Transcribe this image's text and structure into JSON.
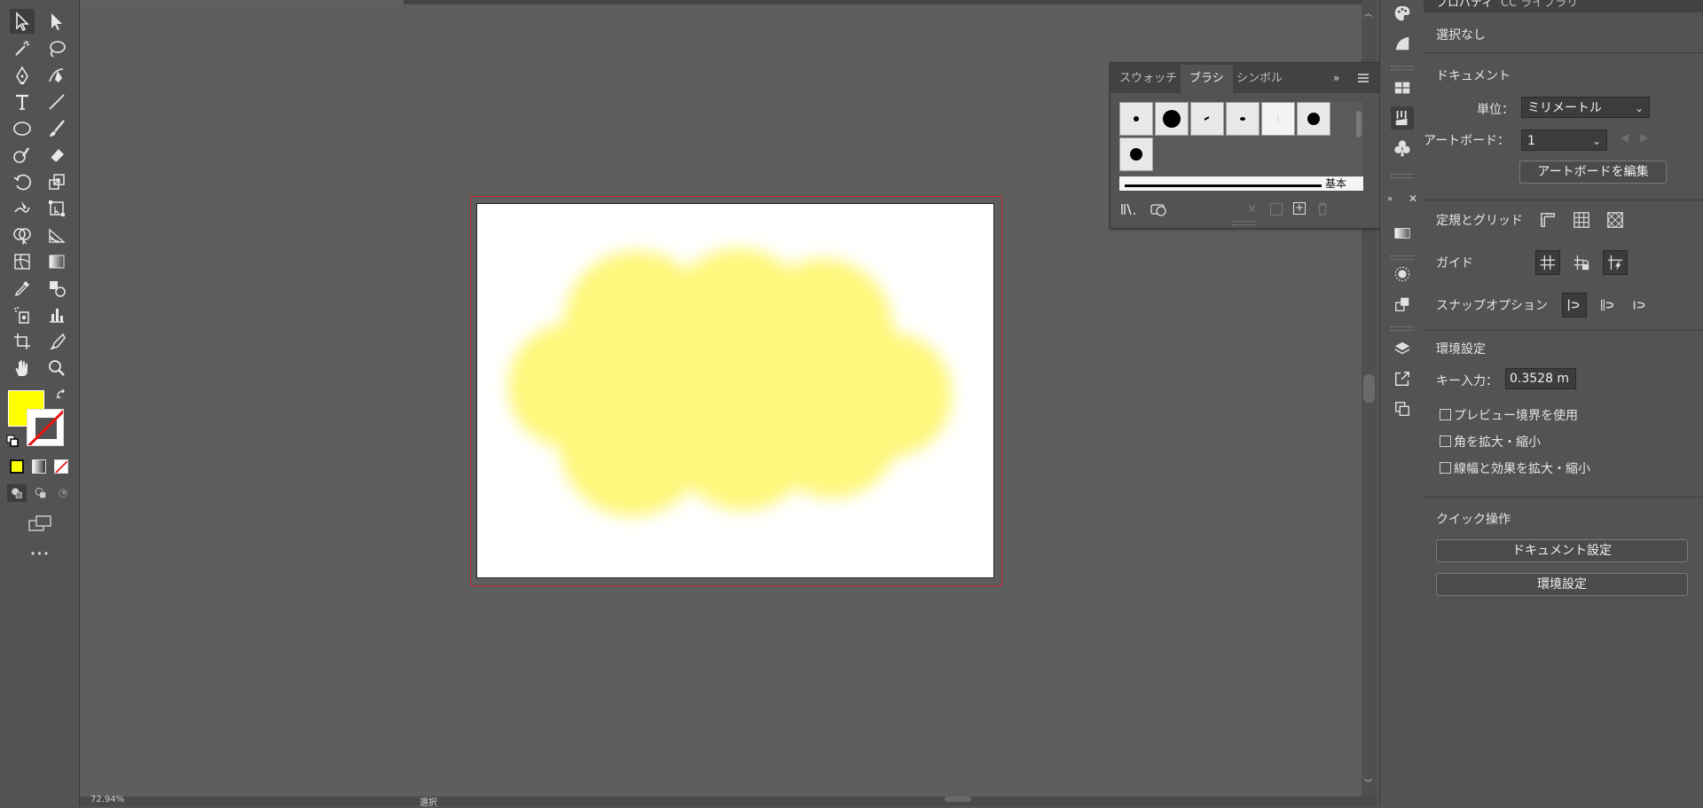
{
  "colors": {
    "fill": "#ffff00",
    "cloud": "#fff77a",
    "artboard_border": "#c0282d",
    "ui_bg": "#535353",
    "canvas_bg": "#5e5e5e"
  },
  "toolbar": {
    "tools": [
      "selection-tool",
      "direct-selection-tool",
      "magic-wand-tool",
      "lasso-tool",
      "pen-tool",
      "curvature-tool",
      "type-tool",
      "line-segment-tool",
      "ellipse-tool",
      "paintbrush-tool",
      "shaper-tool",
      "eraser-tool",
      "rotate-tool",
      "scale-tool",
      "warp-tool",
      "free-transform-tool",
      "shape-builder-tool",
      "perspective-grid-tool",
      "mesh-tool",
      "gradient-tool",
      "eyedropper-tool",
      "blend-tool",
      "symbol-sprayer-tool",
      "column-graph-tool",
      "artboard-tool",
      "slice-tool",
      "hand-tool",
      "zoom-tool"
    ],
    "more_label": "•••"
  },
  "brush_panel": {
    "tabs": [
      "スウォッチ",
      "ブラシ",
      "シンボル"
    ],
    "active_tab": "ブラシ",
    "stroke_label": "基本"
  },
  "props_panel": {
    "tabs": [
      "プロパティ",
      "CC ライブラリ"
    ],
    "selection_none": "選択なし",
    "document_header": "ドキュメント",
    "unit_label": "単位：",
    "unit_value": "ミリメートル",
    "artboard_label": "アートボード：",
    "artboard_value": "1",
    "edit_artboard_button": "アートボードを編集",
    "rulers_grid_label": "定規とグリッド",
    "guides_label": "ガイド",
    "snap_label": "スナップオプション",
    "prefs_header": "環境設定",
    "key_input_label": "キー入力：",
    "key_input_value": "0.3528 m",
    "checkbox_preview_bounds": "プレビュー境界を使用",
    "checkbox_scale_corners": "角を拡大・縮小",
    "checkbox_scale_strokes": "線幅と効果を拡大・縮小",
    "quick_actions_header": "クイック操作",
    "doc_settings_button": "ドキュメント設定",
    "prefs_button": "環境設定"
  },
  "status_bar": {
    "zoom": "72.94%",
    "tool_name": "選択"
  }
}
